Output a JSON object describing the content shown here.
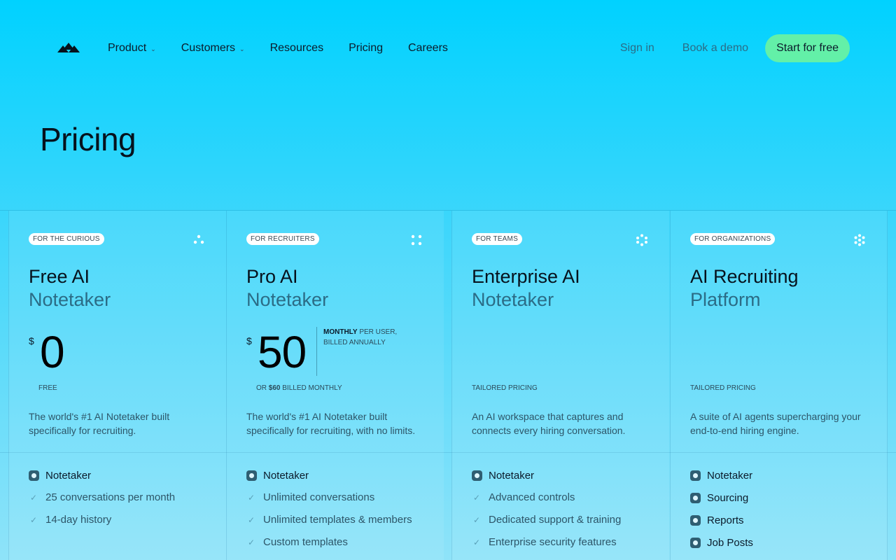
{
  "nav": {
    "logo_icon": "mountain-logo-icon",
    "links": [
      {
        "label": "Product",
        "has_dropdown": true
      },
      {
        "label": "Customers",
        "has_dropdown": true
      },
      {
        "label": "Resources",
        "has_dropdown": false
      },
      {
        "label": "Pricing",
        "has_dropdown": false
      },
      {
        "label": "Careers",
        "has_dropdown": false
      }
    ],
    "sign_in": "Sign in",
    "book_demo": "Book a demo",
    "cta": "Start for free"
  },
  "page": {
    "title": "Pricing"
  },
  "plans": [
    {
      "badge": "For the curious",
      "name": "Free AI",
      "sub": "Notetaker",
      "currency": "$",
      "amount": "0",
      "caption": "Free",
      "description": "The world's #1 AI Notetaker built specifically for recruiting.",
      "features_title": "Notetaker",
      "features": [
        "25 conversations per month",
        "14-day history"
      ]
    },
    {
      "badge": "For recruiters",
      "name": "Pro AI",
      "sub": "Notetaker",
      "currency": "$",
      "amount": "50",
      "note_bold": "Monthly",
      "note_rest": "per user, billed annually",
      "caption_prefix": "or",
      "caption_bold": "$60",
      "caption_suffix": "billed monthly",
      "description": "The world's #1 AI Notetaker built specifically for recruiting, with no limits.",
      "features_title": "Notetaker",
      "features": [
        "Unlimited conversations",
        "Unlimited templates & members",
        "Custom templates"
      ]
    },
    {
      "badge": "For teams",
      "name": "Enterprise AI",
      "sub": "Notetaker",
      "caption": "Tailored pricing",
      "description": "An AI workspace that captures and connects every hiring conversation.",
      "features_title": "Notetaker",
      "features": [
        "Advanced controls",
        "Dedicated support & training",
        "Enterprise security features"
      ]
    },
    {
      "badge": "For organizations",
      "name": "AI Recruiting",
      "sub": "Platform",
      "caption": "Tailored pricing",
      "description": "A suite of AI agents supercharging your end-to-end hiring engine.",
      "modules": [
        "Notetaker",
        "Sourcing",
        "Reports",
        "Job Posts"
      ]
    }
  ],
  "colors": {
    "background_top": "#00d2ff",
    "cta": "#63f0a8",
    "muted_text": "#2b6c86"
  }
}
